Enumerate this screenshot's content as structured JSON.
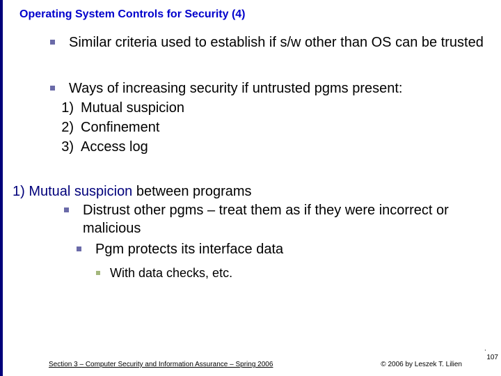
{
  "title": "Operating System Controls for Security (4)",
  "bullets": {
    "b1": "Similar criteria used to establish if s/w other than OS can be trusted",
    "b2": "Ways of increasing security if untrusted pgms present:",
    "list": {
      "n1": "1)",
      "t1": "Mutual suspicion",
      "n2": "2)",
      "t2": "Confinement",
      "n3": "3)",
      "t3": "Access log"
    }
  },
  "section": {
    "prefix": "1) ",
    "highlight": "Mutual suspicion",
    "suffix": " between programs",
    "sub1": "Distrust other pgms – treat them as if they were incorrect or malicious",
    "sub2": "Pgm protects its interface data",
    "sub3": "With data checks, etc."
  },
  "footer": {
    "left": "Section 3 – Computer Security and Information Assurance – Spring 2006",
    "right": "© 2006 by Leszek T. Lilien"
  },
  "page": "107",
  "mark": "'"
}
